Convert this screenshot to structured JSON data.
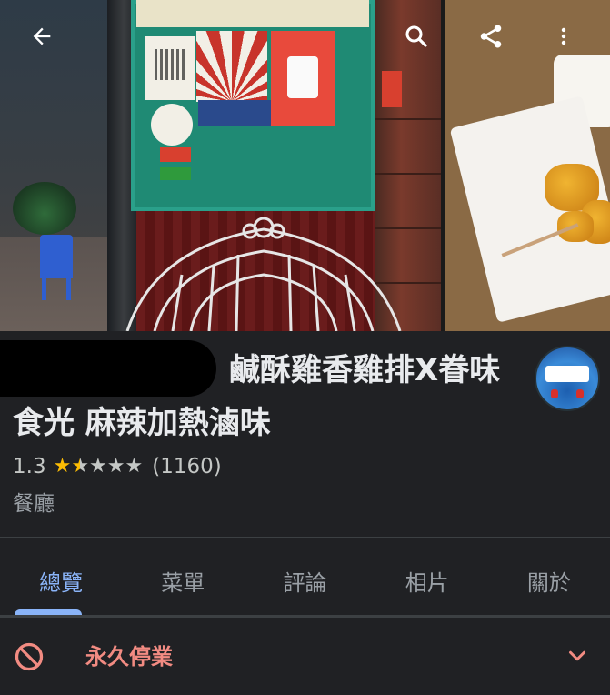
{
  "header": {
    "back_icon": "arrow-back-icon",
    "search_icon": "search-icon",
    "share_icon": "share-icon",
    "more_icon": "more-vert-icon"
  },
  "place": {
    "title": "鹹酥雞香雞排X眷味食光 麻辣加熱滷味",
    "rating": "1.3",
    "stars": 1.3,
    "review_count": "(1160)",
    "category": "餐廳",
    "colors": {
      "star": "#fbbc04",
      "text": "#e8eaed",
      "muted": "#9aa0a6"
    }
  },
  "tabs": [
    {
      "label": "總覽",
      "active": true
    },
    {
      "label": "菜單",
      "active": false
    },
    {
      "label": "評論",
      "active": false
    },
    {
      "label": "相片",
      "active": false
    },
    {
      "label": "關於",
      "active": false
    }
  ],
  "status": {
    "label": "永久停業",
    "icon": "block-icon",
    "chevron_icon": "chevron-down-icon",
    "color": "#f28b82"
  },
  "accent": "#8ab4f8",
  "background": "#202124"
}
